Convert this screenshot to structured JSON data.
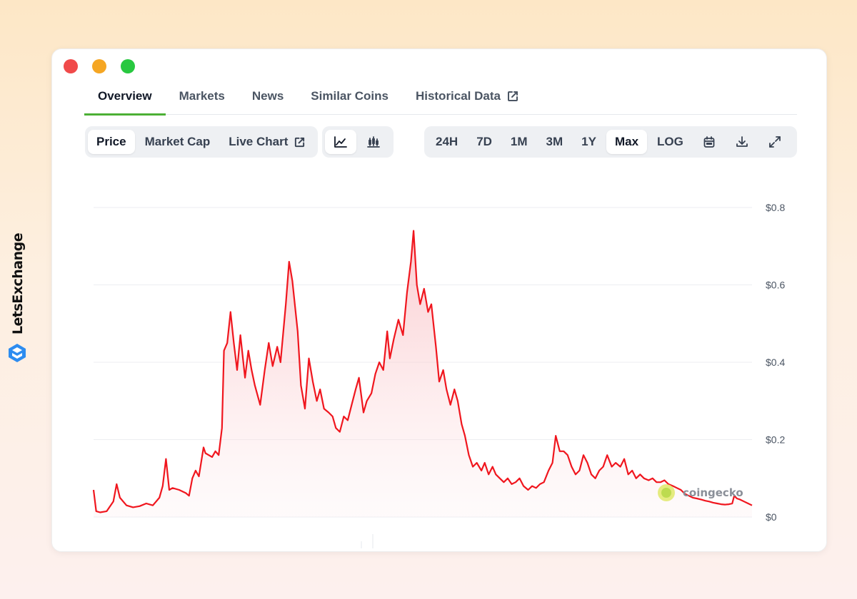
{
  "brand": {
    "name": "LetsExchange"
  },
  "tabs": [
    {
      "label": "Overview",
      "active": true
    },
    {
      "label": "Markets"
    },
    {
      "label": "News"
    },
    {
      "label": "Similar Coins"
    },
    {
      "label": "Historical Data",
      "external": true
    }
  ],
  "toolbar": {
    "type_buttons": [
      {
        "label": "Price",
        "active": true
      },
      {
        "label": "Market Cap"
      },
      {
        "label": "Live Chart",
        "external": true
      }
    ],
    "view_icons": [
      "line-chart-icon",
      "candlestick-chart-icon"
    ],
    "range_buttons": [
      {
        "label": "24H"
      },
      {
        "label": "7D"
      },
      {
        "label": "1M"
      },
      {
        "label": "3M"
      },
      {
        "label": "1Y"
      },
      {
        "label": "Max",
        "active": true
      },
      {
        "label": "LOG"
      }
    ],
    "action_icons": [
      "calendar-icon",
      "download-icon",
      "expand-icon"
    ]
  },
  "colors": {
    "line": "#f0161e",
    "accent": "#4cb035",
    "fill_top": "#fbd0d3"
  },
  "watermark": "coingecko",
  "chart_data": {
    "type": "area",
    "title": "",
    "xlabel": "",
    "ylabel": "",
    "ylim": [
      0,
      0.8
    ],
    "y_ticks": [
      0,
      0.2,
      0.4,
      0.6,
      0.8
    ],
    "y_tick_labels": [
      "$0",
      "$0.2",
      "$0.4",
      "$0.6",
      "$0.8"
    ],
    "grid": true,
    "x_index": "time index (oldest to newest), 0–100",
    "series": [
      {
        "values": [
          [
            0,
            0.07
          ],
          [
            0.4,
            0.015
          ],
          [
            1,
            0.012
          ],
          [
            2,
            0.015
          ],
          [
            3,
            0.04
          ],
          [
            3.5,
            0.085
          ],
          [
            4,
            0.05
          ],
          [
            5,
            0.03
          ],
          [
            6,
            0.025
          ],
          [
            7,
            0.028
          ],
          [
            8,
            0.035
          ],
          [
            9,
            0.03
          ],
          [
            10,
            0.05
          ],
          [
            10.5,
            0.08
          ],
          [
            11,
            0.15
          ],
          [
            11.5,
            0.07
          ],
          [
            12,
            0.075
          ],
          [
            13,
            0.07
          ],
          [
            14,
            0.062
          ],
          [
            14.5,
            0.055
          ],
          [
            15,
            0.1
          ],
          [
            15.5,
            0.12
          ],
          [
            16,
            0.105
          ],
          [
            16.7,
            0.18
          ],
          [
            17,
            0.165
          ],
          [
            18,
            0.155
          ],
          [
            18.5,
            0.17
          ],
          [
            19,
            0.16
          ],
          [
            19.5,
            0.23
          ],
          [
            19.8,
            0.43
          ],
          [
            20.3,
            0.45
          ],
          [
            20.8,
            0.53
          ],
          [
            21.3,
            0.45
          ],
          [
            21.8,
            0.38
          ],
          [
            22.3,
            0.47
          ],
          [
            23,
            0.36
          ],
          [
            23.5,
            0.43
          ],
          [
            24,
            0.38
          ],
          [
            24.5,
            0.34
          ],
          [
            25.3,
            0.29
          ],
          [
            26,
            0.38
          ],
          [
            26.6,
            0.45
          ],
          [
            27.2,
            0.39
          ],
          [
            27.9,
            0.44
          ],
          [
            28.4,
            0.4
          ],
          [
            29.2,
            0.55
          ],
          [
            29.7,
            0.66
          ],
          [
            30.2,
            0.61
          ],
          [
            31,
            0.48
          ],
          [
            31.5,
            0.34
          ],
          [
            32.1,
            0.28
          ],
          [
            32.7,
            0.41
          ],
          [
            33.3,
            0.35
          ],
          [
            33.9,
            0.3
          ],
          [
            34.4,
            0.33
          ],
          [
            35,
            0.28
          ],
          [
            35.7,
            0.27
          ],
          [
            36.3,
            0.26
          ],
          [
            36.8,
            0.23
          ],
          [
            37.4,
            0.22
          ],
          [
            38,
            0.26
          ],
          [
            38.6,
            0.25
          ],
          [
            39.2,
            0.29
          ],
          [
            39.8,
            0.33
          ],
          [
            40.3,
            0.36
          ],
          [
            41,
            0.27
          ],
          [
            41.5,
            0.3
          ],
          [
            42.2,
            0.32
          ],
          [
            42.8,
            0.37
          ],
          [
            43.4,
            0.4
          ],
          [
            44,
            0.38
          ],
          [
            44.6,
            0.48
          ],
          [
            45,
            0.41
          ],
          [
            45.6,
            0.46
          ],
          [
            46.3,
            0.51
          ],
          [
            47,
            0.47
          ],
          [
            47.6,
            0.58
          ],
          [
            48.2,
            0.66
          ],
          [
            48.6,
            0.74
          ],
          [
            49.1,
            0.6
          ],
          [
            49.6,
            0.55
          ],
          [
            50.2,
            0.59
          ],
          [
            50.8,
            0.53
          ],
          [
            51.3,
            0.55
          ],
          [
            52,
            0.44
          ],
          [
            52.5,
            0.35
          ],
          [
            53.1,
            0.38
          ],
          [
            53.6,
            0.33
          ],
          [
            54.2,
            0.29
          ],
          [
            54.8,
            0.33
          ],
          [
            55.3,
            0.3
          ],
          [
            55.9,
            0.24
          ],
          [
            56.4,
            0.21
          ],
          [
            57,
            0.16
          ],
          [
            57.6,
            0.13
          ],
          [
            58.2,
            0.14
          ],
          [
            58.9,
            0.12
          ],
          [
            59.4,
            0.14
          ],
          [
            60,
            0.11
          ],
          [
            60.6,
            0.13
          ],
          [
            61.1,
            0.11
          ],
          [
            61.7,
            0.1
          ],
          [
            62.3,
            0.09
          ],
          [
            62.9,
            0.1
          ],
          [
            63.5,
            0.085
          ],
          [
            64.1,
            0.09
          ],
          [
            64.7,
            0.1
          ],
          [
            65.3,
            0.08
          ],
          [
            66,
            0.07
          ],
          [
            66.6,
            0.08
          ],
          [
            67.2,
            0.075
          ],
          [
            67.8,
            0.085
          ],
          [
            68.4,
            0.09
          ],
          [
            69.1,
            0.12
          ],
          [
            69.7,
            0.14
          ],
          [
            70.2,
            0.21
          ],
          [
            70.8,
            0.17
          ],
          [
            71.4,
            0.17
          ],
          [
            72,
            0.16
          ],
          [
            72.6,
            0.13
          ],
          [
            73.2,
            0.11
          ],
          [
            73.8,
            0.12
          ],
          [
            74.4,
            0.16
          ],
          [
            75,
            0.14
          ],
          [
            75.6,
            0.11
          ],
          [
            76.2,
            0.1
          ],
          [
            76.8,
            0.12
          ],
          [
            77.4,
            0.13
          ],
          [
            78,
            0.16
          ],
          [
            78.7,
            0.13
          ],
          [
            79.3,
            0.14
          ],
          [
            80,
            0.13
          ],
          [
            80.6,
            0.15
          ],
          [
            81.2,
            0.11
          ],
          [
            81.8,
            0.12
          ],
          [
            82.4,
            0.1
          ],
          [
            83,
            0.11
          ],
          [
            83.6,
            0.1
          ],
          [
            84.3,
            0.095
          ],
          [
            84.9,
            0.1
          ],
          [
            85.5,
            0.09
          ],
          [
            86.1,
            0.09
          ],
          [
            86.7,
            0.095
          ],
          [
            87.3,
            0.085
          ],
          [
            88,
            0.08
          ],
          [
            88.6,
            0.075
          ],
          [
            89.2,
            0.07
          ],
          [
            89.8,
            0.06
          ],
          [
            90.4,
            0.055
          ],
          [
            91,
            0.05
          ],
          [
            91.6,
            0.048
          ],
          [
            92.3,
            0.045
          ],
          [
            92.9,
            0.042
          ],
          [
            93.5,
            0.04
          ],
          [
            94.1,
            0.037
          ],
          [
            94.7,
            0.035
          ],
          [
            95.3,
            0.033
          ],
          [
            95.9,
            0.032
          ],
          [
            96.5,
            0.033
          ],
          [
            97,
            0.035
          ],
          [
            97.3,
            0.055
          ],
          [
            97.7,
            0.048
          ],
          [
            98.2,
            0.045
          ],
          [
            98.8,
            0.04
          ],
          [
            99.4,
            0.035
          ],
          [
            100,
            0.03
          ]
        ]
      }
    ]
  }
}
